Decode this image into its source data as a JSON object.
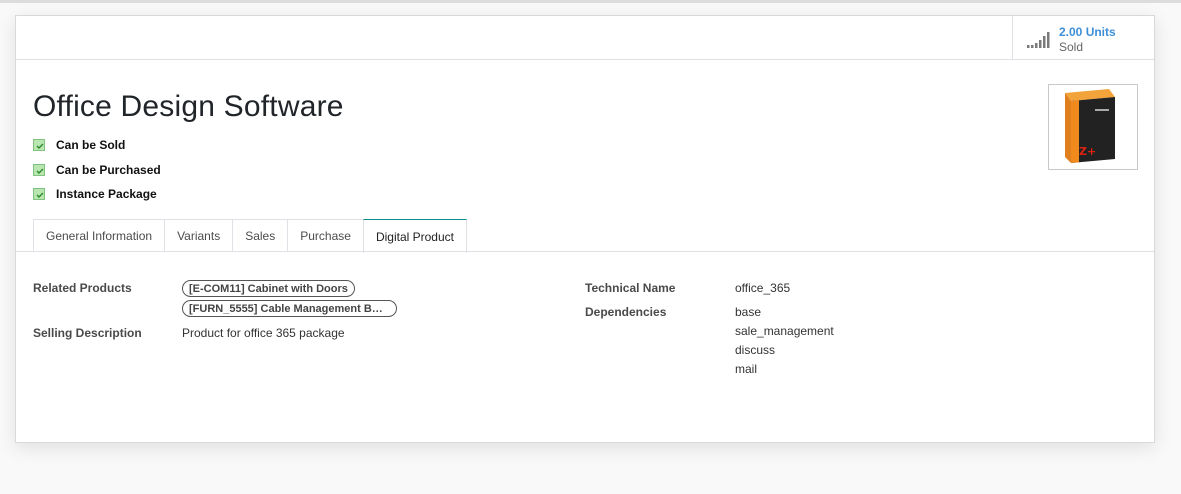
{
  "stat": {
    "value": "2.00 Units",
    "label": "Sold",
    "icon": "signal-bars-icon"
  },
  "product": {
    "name": "Office Design Software",
    "image_icon": "software-box-icon",
    "checkboxes": [
      {
        "label": "Can be Sold",
        "checked": true
      },
      {
        "label": "Can be Purchased",
        "checked": true
      },
      {
        "label": "Instance Package",
        "checked": true
      }
    ]
  },
  "tabs": [
    {
      "label": "General Information",
      "active": false
    },
    {
      "label": "Variants",
      "active": false
    },
    {
      "label": "Sales",
      "active": false
    },
    {
      "label": "Purchase",
      "active": false
    },
    {
      "label": "Digital Product",
      "active": true
    }
  ],
  "fields": {
    "related_products_label": "Related Products",
    "related_products": [
      "[E-COM11] Cabinet with Doors",
      "[FURN_5555] Cable Management B…"
    ],
    "selling_description_label": "Selling Description",
    "selling_description": "Product for office 365 package",
    "technical_name_label": "Technical Name",
    "technical_name": "office_365",
    "dependencies_label": "Dependencies",
    "dependencies": [
      "base",
      "sale_management",
      "discuss",
      "mail"
    ]
  },
  "colors": {
    "accent": "#3d8fd8",
    "active_tab_border": "#0b8a8a",
    "checkbox_fill": "#b9e5b0"
  }
}
